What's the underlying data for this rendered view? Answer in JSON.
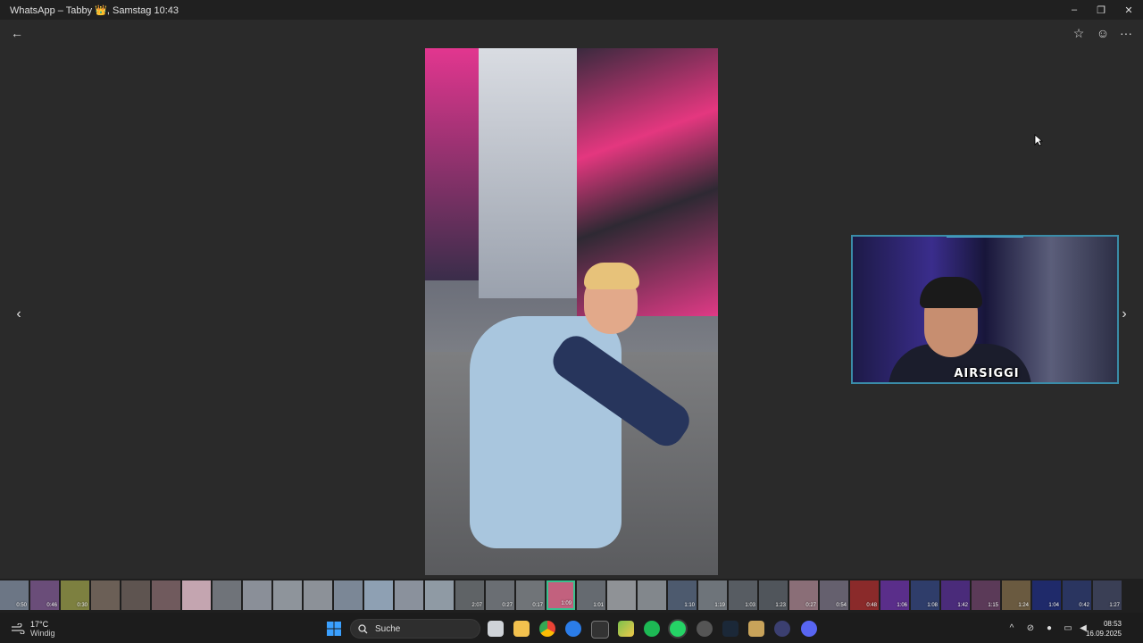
{
  "window": {
    "title": "WhatsApp – Tabby 👑, Samstag 10:43",
    "minimize": "–",
    "maximize": "❐",
    "close": "✕"
  },
  "toolbar": {
    "back_icon": "←",
    "star_icon": "☆",
    "emoji_icon": "☺",
    "more_icon": "···"
  },
  "viewer": {
    "prev_icon": "‹",
    "next_icon": "›"
  },
  "webcam": {
    "name_overlay": "AIRSIGGI"
  },
  "filmstrip": {
    "thumbs": [
      {
        "dur": "0:50",
        "color": "#6c7685"
      },
      {
        "dur": "0:46",
        "color": "#6a4d79"
      },
      {
        "dur": "0:30",
        "color": "#7d8040"
      },
      {
        "dur": "",
        "color": "#6b5f56"
      },
      {
        "dur": "",
        "color": "#5e5450"
      },
      {
        "dur": "",
        "color": "#705a5d"
      },
      {
        "dur": "",
        "color": "#c4a5b0"
      },
      {
        "dur": "",
        "color": "#6f7379"
      },
      {
        "dur": "",
        "color": "#8a8f98"
      },
      {
        "dur": "",
        "color": "#8e949b"
      },
      {
        "dur": "",
        "color": "#8c9198"
      },
      {
        "dur": "",
        "color": "#7b8796"
      },
      {
        "dur": "",
        "color": "#8ea0b3"
      },
      {
        "dur": "",
        "color": "#8a919c"
      },
      {
        "dur": "",
        "color": "#8f9aa4"
      },
      {
        "dur": "2:07",
        "color": "#5f6366"
      },
      {
        "dur": "0:27",
        "color": "#6a6e73"
      },
      {
        "dur": "0:17",
        "color": "#707478"
      },
      {
        "dur": "1:09",
        "color": "#c2617e",
        "selected": true
      },
      {
        "dur": "1:01",
        "color": "#656a70"
      },
      {
        "dur": "",
        "color": "#8f9296"
      },
      {
        "dur": "",
        "color": "#82878c"
      },
      {
        "dur": "1:10",
        "color": "#4d5a6e"
      },
      {
        "dur": "1:19",
        "color": "#6e747a"
      },
      {
        "dur": "1:03",
        "color": "#575c62"
      },
      {
        "dur": "1:23",
        "color": "#50555b"
      },
      {
        "dur": "0:27",
        "color": "#8a6e77"
      },
      {
        "dur": "0:54",
        "color": "#65606e"
      },
      {
        "dur": "0:48",
        "color": "#8a2a2a"
      },
      {
        "dur": "1:06",
        "color": "#5a2e8a"
      },
      {
        "dur": "1:08",
        "color": "#2f3d6a"
      },
      {
        "dur": "1:42",
        "color": "#4a2b7a"
      },
      {
        "dur": "1:15",
        "color": "#5b3a58"
      },
      {
        "dur": "1:24",
        "color": "#6a5a40"
      },
      {
        "dur": "1:04",
        "color": "#1f2a6a"
      },
      {
        "dur": "0:42",
        "color": "#2a3560"
      },
      {
        "dur": "1:27",
        "color": "#3a3f55"
      }
    ]
  },
  "taskbar": {
    "weather_temp": "17°C",
    "weather_desc": "Windig",
    "search_label": "Suche",
    "time": "08:53",
    "date": "16.09.2025"
  }
}
